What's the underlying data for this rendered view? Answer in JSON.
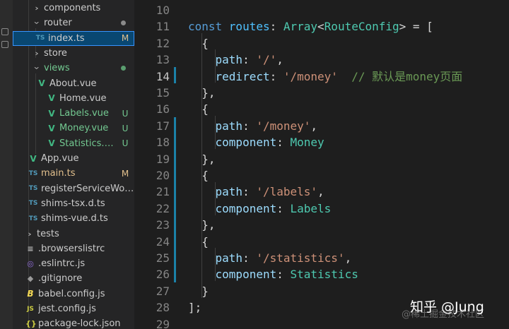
{
  "explorer": {
    "items": [
      {
        "name": "components",
        "kind": "folder",
        "open": false
      },
      {
        "name": "router",
        "kind": "folder",
        "open": true,
        "dot": "#8a8a8a"
      },
      {
        "name": "index.ts",
        "kind": "ts",
        "badge": "M",
        "selected": true
      },
      {
        "name": "store",
        "kind": "folder",
        "open": false
      },
      {
        "name": "views",
        "kind": "folder",
        "open": true,
        "status": "green",
        "dot": "#5a9e6f"
      },
      {
        "name": "About.vue",
        "kind": "vue"
      },
      {
        "name": "Home.vue",
        "kind": "vue"
      },
      {
        "name": "Labels.vue",
        "kind": "vue",
        "status": "green",
        "badge": "U"
      },
      {
        "name": "Money.vue",
        "kind": "vue",
        "status": "green",
        "badge": "U"
      },
      {
        "name": "Statistics.vue",
        "kind": "vue",
        "status": "green",
        "badge": "U"
      },
      {
        "name": "App.vue",
        "kind": "vue"
      },
      {
        "name": "main.ts",
        "kind": "ts",
        "status": "gold",
        "badge": "M"
      },
      {
        "name": "registerServiceWork...",
        "kind": "ts"
      },
      {
        "name": "shims-tsx.d.ts",
        "kind": "ts"
      },
      {
        "name": "shims-vue.d.ts",
        "kind": "ts"
      },
      {
        "name": "tests",
        "kind": "folder",
        "open": false
      },
      {
        "name": ".browserslistrc",
        "kind": "lines"
      },
      {
        "name": ".eslintrc.js",
        "kind": "eslint"
      },
      {
        "name": ".gitignore",
        "kind": "git"
      },
      {
        "name": "babel.config.js",
        "kind": "babel"
      },
      {
        "name": "jest.config.js",
        "kind": "js"
      },
      {
        "name": "package-lock.json",
        "kind": "json"
      }
    ],
    "icons": {
      "ts": "TS",
      "vue": "V",
      "lines": "≡",
      "eslint": "◎",
      "git": "◆",
      "babel": "B",
      "js": "JS",
      "json": "{}"
    }
  },
  "editor": {
    "active_line": 14,
    "lines": [
      {
        "n": "10",
        "tokens": []
      },
      {
        "n": "11",
        "tokens": [
          [
            "kw",
            "const "
          ],
          [
            "var",
            "routes"
          ],
          [
            "punc",
            ": "
          ],
          [
            "type",
            "Array"
          ],
          [
            "punc",
            "<"
          ],
          [
            "type",
            "RouteConfig"
          ],
          [
            "punc",
            "> = ["
          ]
        ]
      },
      {
        "n": "12",
        "tokens": [
          [
            "punc",
            "  {"
          ]
        ]
      },
      {
        "n": "13",
        "tokens": [
          [
            "punc",
            "    "
          ],
          [
            "prop",
            "path"
          ],
          [
            "punc",
            ": "
          ],
          [
            "str",
            "'/'"
          ],
          [
            "punc",
            ","
          ]
        ]
      },
      {
        "n": "14",
        "tokens": [
          [
            "punc",
            "    "
          ],
          [
            "prop",
            "redirect"
          ],
          [
            "punc",
            ": "
          ],
          [
            "str",
            "'/money'"
          ],
          [
            "punc",
            "  "
          ],
          [
            "com",
            "// 默认是money页面"
          ]
        ]
      },
      {
        "n": "15",
        "tokens": [
          [
            "punc",
            "  },"
          ]
        ]
      },
      {
        "n": "16",
        "tokens": [
          [
            "punc",
            "  {"
          ]
        ]
      },
      {
        "n": "17",
        "tokens": [
          [
            "punc",
            "    "
          ],
          [
            "prop",
            "path"
          ],
          [
            "punc",
            ": "
          ],
          [
            "str",
            "'/money'"
          ],
          [
            "punc",
            ","
          ]
        ]
      },
      {
        "n": "18",
        "tokens": [
          [
            "punc",
            "    "
          ],
          [
            "prop",
            "component"
          ],
          [
            "punc",
            ": "
          ],
          [
            "type",
            "Money"
          ]
        ]
      },
      {
        "n": "19",
        "tokens": [
          [
            "punc",
            "  },"
          ]
        ]
      },
      {
        "n": "20",
        "tokens": [
          [
            "punc",
            "  {"
          ]
        ]
      },
      {
        "n": "21",
        "tokens": [
          [
            "punc",
            "    "
          ],
          [
            "prop",
            "path"
          ],
          [
            "punc",
            ": "
          ],
          [
            "str",
            "'/labels'"
          ],
          [
            "punc",
            ","
          ]
        ]
      },
      {
        "n": "22",
        "tokens": [
          [
            "punc",
            "    "
          ],
          [
            "prop",
            "component"
          ],
          [
            "punc",
            ": "
          ],
          [
            "type",
            "Labels"
          ]
        ]
      },
      {
        "n": "23",
        "tokens": [
          [
            "punc",
            "  },"
          ]
        ]
      },
      {
        "n": "24",
        "tokens": [
          [
            "punc",
            "  {"
          ]
        ]
      },
      {
        "n": "25",
        "tokens": [
          [
            "punc",
            "    "
          ],
          [
            "prop",
            "path"
          ],
          [
            "punc",
            ": "
          ],
          [
            "str",
            "'/statistics'"
          ],
          [
            "punc",
            ","
          ]
        ]
      },
      {
        "n": "26",
        "tokens": [
          [
            "punc",
            "    "
          ],
          [
            "prop",
            "component"
          ],
          [
            "punc",
            ": "
          ],
          [
            "type",
            "Statistics"
          ]
        ]
      },
      {
        "n": "27",
        "tokens": [
          [
            "punc",
            "  }"
          ]
        ]
      },
      {
        "n": "28",
        "tokens": [
          [
            "punc",
            "];"
          ]
        ]
      },
      {
        "n": "29",
        "tokens": []
      }
    ]
  },
  "watermark": {
    "main": "知乎 @Jung",
    "sub": "@稀土掘金技术社区"
  },
  "colors": {
    "accent": "#3794ff",
    "selected_bg": "#094771",
    "modified": "#e2c08d",
    "untracked": "#73c991"
  }
}
